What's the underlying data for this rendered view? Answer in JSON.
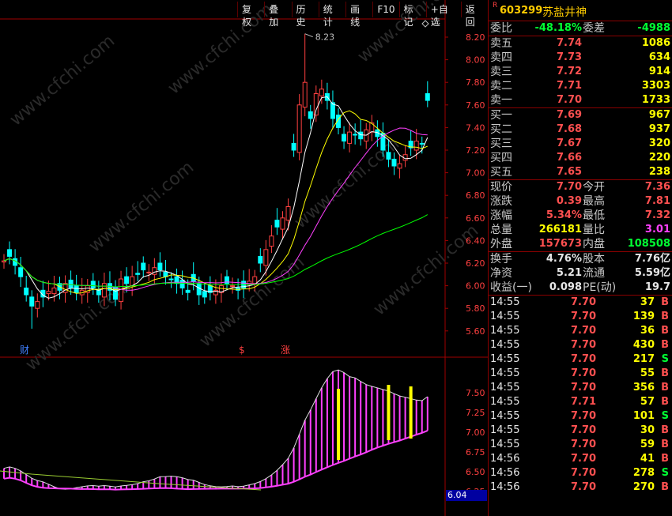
{
  "toolbar": [
    "复权",
    "叠加",
    "历史",
    "统计",
    "画线",
    "F10",
    "标记",
    "+自选",
    "返回"
  ],
  "stock": {
    "badge": "R",
    "code": "603299",
    "name": "苏盐井神"
  },
  "weibi": {
    "label": "委比",
    "value": "-48.18%",
    "label2": "委差",
    "value2": "-4988"
  },
  "asks": [
    {
      "label": "卖五",
      "price": "7.74",
      "vol": "1086"
    },
    {
      "label": "卖四",
      "price": "7.73",
      "vol": "634"
    },
    {
      "label": "卖三",
      "price": "7.72",
      "vol": "914"
    },
    {
      "label": "卖二",
      "price": "7.71",
      "vol": "3303"
    },
    {
      "label": "卖一",
      "price": "7.70",
      "vol": "1733"
    }
  ],
  "bids": [
    {
      "label": "买一",
      "price": "7.69",
      "vol": "967"
    },
    {
      "label": "买二",
      "price": "7.68",
      "vol": "937"
    },
    {
      "label": "买三",
      "price": "7.67",
      "vol": "320"
    },
    {
      "label": "买四",
      "price": "7.66",
      "vol": "220"
    },
    {
      "label": "买五",
      "price": "7.65",
      "vol": "238"
    }
  ],
  "quote": [
    {
      "l1": "现价",
      "v1": "7.70",
      "c1": "red",
      "l2": "今开",
      "v2": "7.36",
      "c2": "red"
    },
    {
      "l1": "涨跌",
      "v1": "0.39",
      "c1": "red",
      "l2": "最高",
      "v2": "7.81",
      "c2": "red"
    },
    {
      "l1": "涨幅",
      "v1": "5.34%",
      "c1": "red",
      "l2": "最低",
      "v2": "7.32",
      "c2": "red"
    },
    {
      "l1": "总量",
      "v1": "266181",
      "c1": "yellow",
      "l2": "量比",
      "v2": "3.01",
      "c2": "magenta"
    },
    {
      "l1": "外盘",
      "v1": "157673",
      "c1": "red",
      "l2": "内盘",
      "v2": "108508",
      "c2": "green"
    }
  ],
  "finance": [
    {
      "l1": "换手",
      "v1": "4.76%",
      "l2": "股本",
      "v2": "7.76亿"
    },
    {
      "l1": "净资",
      "v1": "5.21",
      "l2": "流通",
      "v2": "5.59亿"
    },
    {
      "l1": "收益(一)",
      "v1": "0.098",
      "l2": "PE(动)",
      "v2": "19.7"
    }
  ],
  "ticks": [
    {
      "time": "14:55",
      "price": "7.70",
      "vol": "37",
      "dir": "B"
    },
    {
      "time": "14:55",
      "price": "7.70",
      "vol": "139",
      "dir": "B"
    },
    {
      "time": "14:55",
      "price": "7.70",
      "vol": "36",
      "dir": "B"
    },
    {
      "time": "14:55",
      "price": "7.70",
      "vol": "430",
      "dir": "B"
    },
    {
      "time": "14:55",
      "price": "7.70",
      "vol": "217",
      "dir": "S"
    },
    {
      "time": "14:55",
      "price": "7.70",
      "vol": "55",
      "dir": "B"
    },
    {
      "time": "14:55",
      "price": "7.70",
      "vol": "356",
      "dir": "B"
    },
    {
      "time": "14:55",
      "price": "7.71",
      "vol": "57",
      "dir": "B"
    },
    {
      "time": "14:55",
      "price": "7.70",
      "vol": "101",
      "dir": "S"
    },
    {
      "time": "14:55",
      "price": "7.70",
      "vol": "30",
      "dir": "B"
    },
    {
      "time": "14:55",
      "price": "7.70",
      "vol": "59",
      "dir": "B"
    },
    {
      "time": "14:56",
      "price": "7.70",
      "vol": "41",
      "dir": "B"
    },
    {
      "time": "14:56",
      "price": "7.70",
      "vol": "278",
      "dir": "S"
    },
    {
      "time": "14:56",
      "price": "7.70",
      "vol": "270",
      "dir": "B"
    }
  ],
  "chart_data": {
    "type": "candlestick",
    "price_axis": [
      5.6,
      5.8,
      6.0,
      6.2,
      6.4,
      6.6,
      6.8,
      7.0,
      7.2,
      7.4,
      7.6,
      7.8,
      8.0,
      8.2
    ],
    "high_label": "8.23",
    "markers": [
      "财",
      "$",
      "涨"
    ],
    "indicator_axis": [
      6.25,
      6.5,
      6.75,
      7.0,
      7.25,
      7.5
    ],
    "indicator_badge": "6.04",
    "watermark": "www.cfchi.com",
    "closes": [
      6.22,
      6.26,
      6.18,
      6.08,
      5.92,
      5.82,
      5.86,
      5.9,
      5.95,
      5.98,
      5.96,
      6.02,
      5.98,
      5.94,
      5.96,
      6.0,
      5.98,
      5.92,
      6.02,
      5.96,
      5.88,
      6.06,
      6.02,
      6.08,
      6.1,
      6.14,
      6.12,
      6.16,
      6.14,
      6.08,
      6.06,
      6.02,
      5.98,
      5.94,
      6.04,
      5.92,
      5.9,
      5.94,
      5.96,
      6.0,
      6.02,
      6.0,
      5.96,
      5.98,
      6.04,
      6.08,
      6.2,
      6.32,
      6.44,
      6.52,
      6.6,
      6.7,
      7.2,
      7.6,
      7.8,
      7.48,
      7.7,
      7.74,
      7.64,
      7.48,
      7.4,
      7.28,
      7.36,
      7.34,
      7.3,
      7.38,
      7.44,
      7.32,
      7.2,
      7.12,
      7.06,
      7.08,
      7.16,
      7.22,
      7.28,
      7.26,
      7.64
    ]
  }
}
